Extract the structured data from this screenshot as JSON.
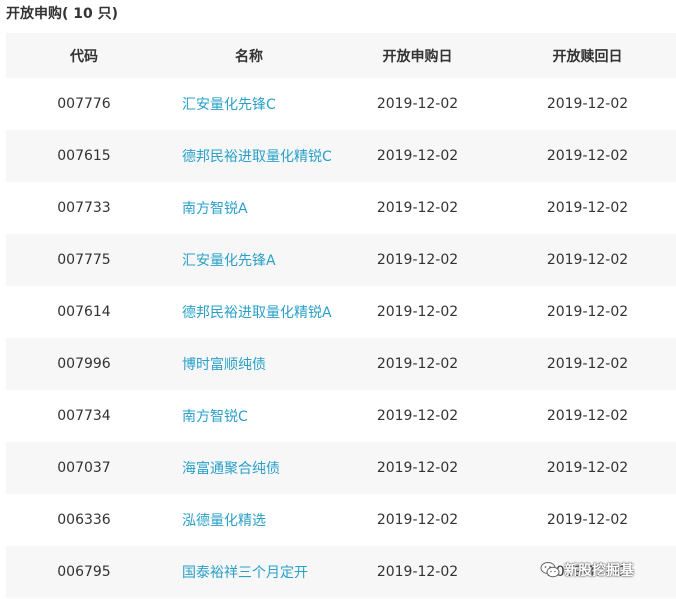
{
  "header": {
    "title": "开放申购( 10 只)"
  },
  "table": {
    "columns": [
      "代码",
      "名称",
      "开放申购日",
      "开放赎回日"
    ],
    "rows": [
      {
        "code": "007776",
        "name": "汇安量化先锋C",
        "subscribe_date": "2019-12-02",
        "redeem_date": "2019-12-02"
      },
      {
        "code": "007615",
        "name": "德邦民裕进取量化精锐C",
        "subscribe_date": "2019-12-02",
        "redeem_date": "2019-12-02"
      },
      {
        "code": "007733",
        "name": "南方智锐A",
        "subscribe_date": "2019-12-02",
        "redeem_date": "2019-12-02"
      },
      {
        "code": "007775",
        "name": "汇安量化先锋A",
        "subscribe_date": "2019-12-02",
        "redeem_date": "2019-12-02"
      },
      {
        "code": "007614",
        "name": "德邦民裕进取量化精锐A",
        "subscribe_date": "2019-12-02",
        "redeem_date": "2019-12-02"
      },
      {
        "code": "007996",
        "name": "博时富顺纯债",
        "subscribe_date": "2019-12-02",
        "redeem_date": "2019-12-02"
      },
      {
        "code": "007734",
        "name": "南方智锐C",
        "subscribe_date": "2019-12-02",
        "redeem_date": "2019-12-02"
      },
      {
        "code": "007037",
        "name": "海富通聚合纯债",
        "subscribe_date": "2019-12-02",
        "redeem_date": "2019-12-02"
      },
      {
        "code": "006336",
        "name": "泓德量化精选",
        "subscribe_date": "2019-12-02",
        "redeem_date": "2019-12-02"
      },
      {
        "code": "006795",
        "name": "国泰裕祥三个月定开",
        "subscribe_date": "2019-12-02",
        "redeem_date": "2019-12-02"
      }
    ]
  },
  "watermark": {
    "text": "新股挖掘基",
    "icon": "wechat-icon"
  },
  "colors": {
    "link": "#2aa0c8",
    "stripe": "#f7f7f7",
    "text": "#333333"
  }
}
